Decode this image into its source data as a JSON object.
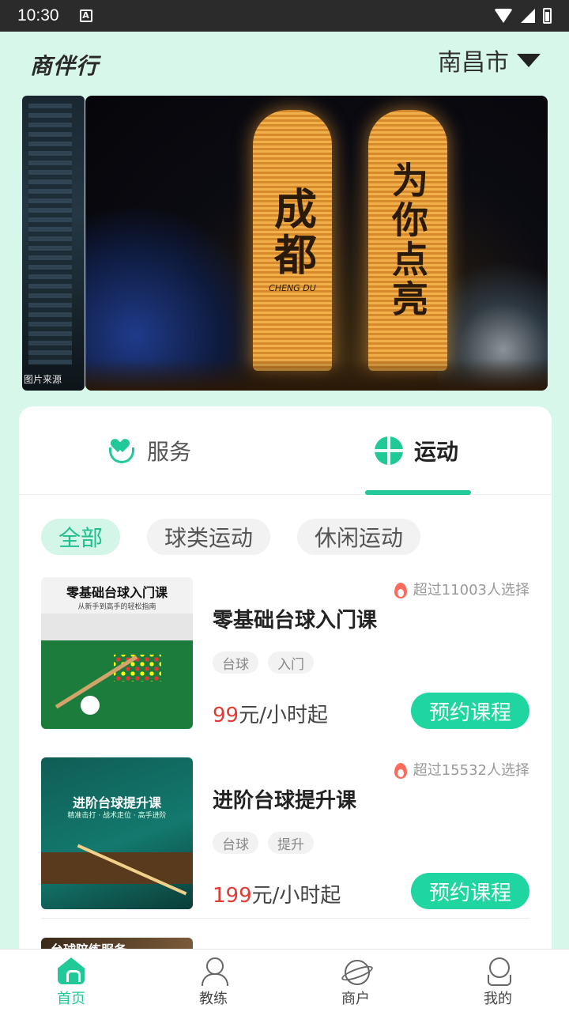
{
  "status_bar": {
    "time": "10:30",
    "notification": "A"
  },
  "header": {
    "logo": "商伴行",
    "city": "南昌市"
  },
  "banner": {
    "prev_caption": "图片来源",
    "left_tower_text": "成都",
    "left_tower_sub": "CHENG DU",
    "right_tower_text": "为你点亮"
  },
  "tabs": [
    {
      "label": "服务",
      "icon": "heart-hand-icon"
    },
    {
      "label": "运动",
      "icon": "basketball-icon",
      "active": true
    }
  ],
  "filters": [
    {
      "label": "全部",
      "active": true
    },
    {
      "label": "球类运动"
    },
    {
      "label": "休闲运动"
    }
  ],
  "courses": [
    {
      "thumb_title": "零基础台球入门课",
      "thumb_sub": "从新手到高手的轻松指南",
      "title": "零基础台球入门课",
      "popularity": "超过11003人选择",
      "tags": [
        "台球",
        "入门"
      ],
      "price_num": "99",
      "price_unit": "元/小时起",
      "button": "预约课程"
    },
    {
      "thumb_title": "进阶台球提升课",
      "thumb_sub": "精准击打 · 战术走位 · 高手进阶",
      "title": "进阶台球提升课",
      "popularity": "超过15532人选择",
      "tags": [
        "台球",
        "提升"
      ],
      "price_num": "199",
      "price_unit": "元/小时起",
      "button": "预约课程"
    },
    {
      "thumb_title": "台球陪练服务"
    }
  ],
  "bottom_nav": [
    {
      "label": "首页",
      "icon": "home-icon",
      "active": true
    },
    {
      "label": "教练",
      "icon": "coach-icon"
    },
    {
      "label": "商户",
      "icon": "planet-icon"
    },
    {
      "label": "我的",
      "icon": "profile-icon"
    }
  ],
  "colors": {
    "accent": "#20c997",
    "price": "#e33a33",
    "background": "#d7f7ea"
  }
}
